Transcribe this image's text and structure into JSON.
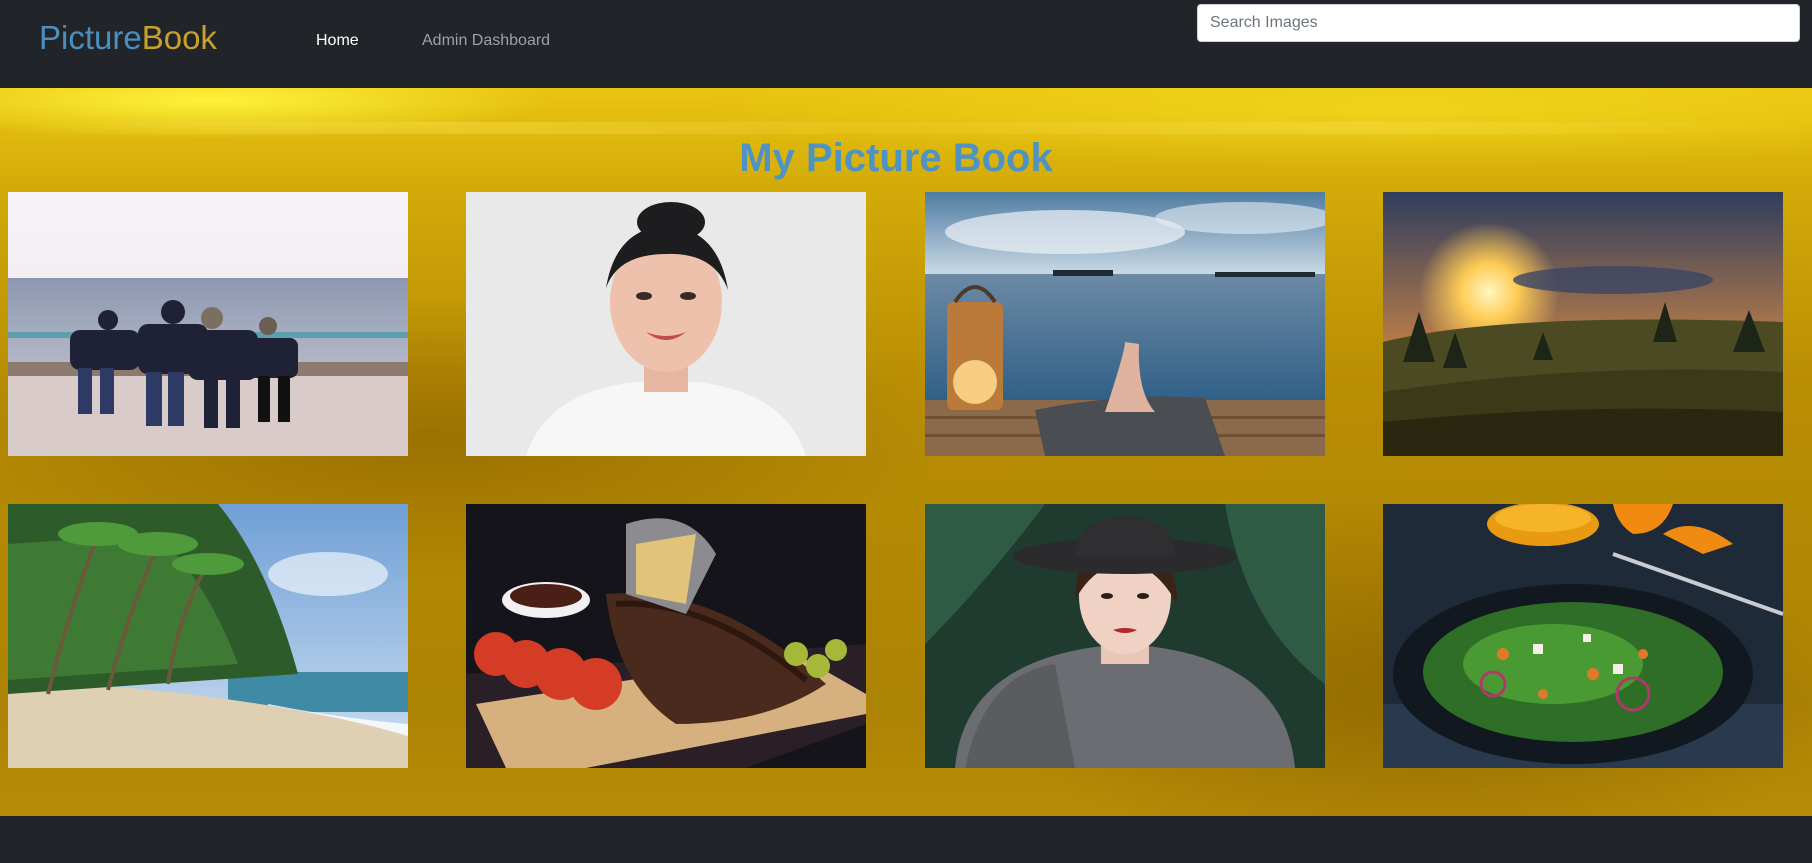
{
  "brand": {
    "part1": "Picture",
    "part2": "Book"
  },
  "nav": {
    "home": "Home",
    "admin": "Admin Dashboard"
  },
  "search": {
    "placeholder": "Search Images"
  },
  "main": {
    "title": "My Picture Book"
  },
  "colors": {
    "brand_blue": "#4a8fc0",
    "brand_gold": "#c6a22c",
    "navbar_bg": "#212529"
  }
}
